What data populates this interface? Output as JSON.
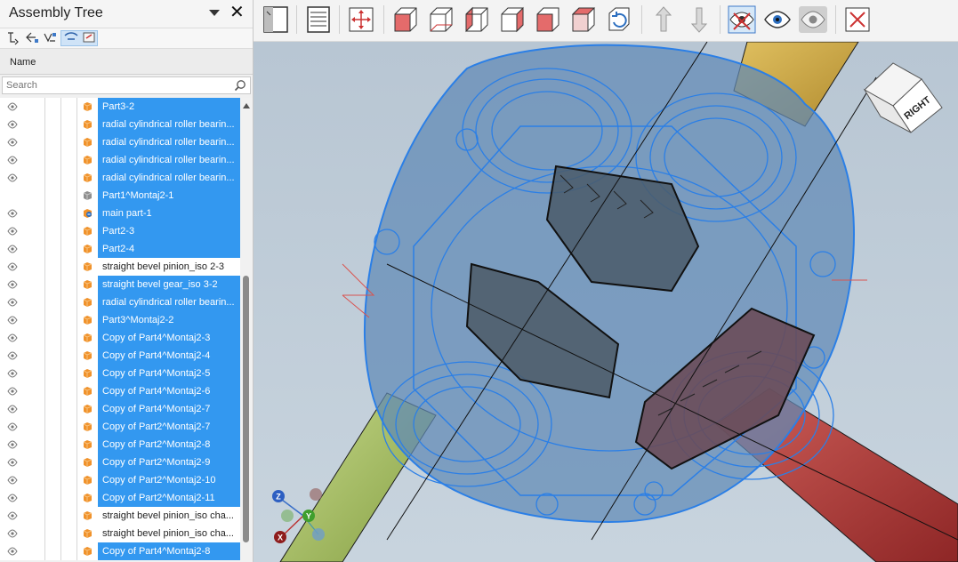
{
  "panel": {
    "title": "Assembly Tree",
    "column_header": "Name",
    "search_placeholder": "Search"
  },
  "tree": {
    "rows": [
      {
        "label": "Part3-2",
        "selected": true,
        "eye": true,
        "icon": "part-icon"
      },
      {
        "label": "radial cylindrical roller bearin...",
        "selected": true,
        "eye": true,
        "icon": "part-icon"
      },
      {
        "label": "radial cylindrical roller bearin...",
        "selected": true,
        "eye": true,
        "icon": "part-icon"
      },
      {
        "label": "radial cylindrical roller bearin...",
        "selected": true,
        "eye": true,
        "icon": "part-icon"
      },
      {
        "label": "radial cylindrical roller bearin...",
        "selected": true,
        "eye": true,
        "icon": "part-icon"
      },
      {
        "label": "Part1^Montaj2-1",
        "selected": true,
        "eye": false,
        "icon": "part-hidden-icon"
      },
      {
        "label": "main part-1",
        "selected": true,
        "eye": true,
        "icon": "assembly-icon"
      },
      {
        "label": "Part2-3",
        "selected": true,
        "eye": true,
        "icon": "part-icon"
      },
      {
        "label": "Part2-4",
        "selected": true,
        "eye": true,
        "icon": "part-icon"
      },
      {
        "label": "straight bevel pinion_iso 2-3",
        "selected": false,
        "eye": true,
        "icon": "part-icon"
      },
      {
        "label": "straight bevel gear_iso 3-2",
        "selected": true,
        "eye": true,
        "icon": "part-icon"
      },
      {
        "label": "radial cylindrical roller bearin...",
        "selected": true,
        "eye": true,
        "icon": "part-icon"
      },
      {
        "label": "Part3^Montaj2-2",
        "selected": true,
        "eye": true,
        "icon": "part-icon"
      },
      {
        "label": "Copy of Part4^Montaj2-3",
        "selected": true,
        "eye": true,
        "icon": "part-icon"
      },
      {
        "label": "Copy of Part4^Montaj2-4",
        "selected": true,
        "eye": true,
        "icon": "part-icon"
      },
      {
        "label": "Copy of Part4^Montaj2-5",
        "selected": true,
        "eye": true,
        "icon": "part-icon"
      },
      {
        "label": "Copy of Part4^Montaj2-6",
        "selected": true,
        "eye": true,
        "icon": "part-icon"
      },
      {
        "label": "Copy of Part4^Montaj2-7",
        "selected": true,
        "eye": true,
        "icon": "part-icon"
      },
      {
        "label": "Copy of Part2^Montaj2-7",
        "selected": true,
        "eye": true,
        "icon": "part-icon"
      },
      {
        "label": "Copy of Part2^Montaj2-8",
        "selected": true,
        "eye": true,
        "icon": "part-icon"
      },
      {
        "label": "Copy of Part2^Montaj2-9",
        "selected": true,
        "eye": true,
        "icon": "part-icon"
      },
      {
        "label": "Copy of Part2^Montaj2-10",
        "selected": true,
        "eye": true,
        "icon": "part-icon"
      },
      {
        "label": "Copy of Part2^Montaj2-11",
        "selected": true,
        "eye": true,
        "icon": "part-icon"
      },
      {
        "label": "straight bevel pinion_iso cha...",
        "selected": false,
        "eye": true,
        "icon": "part-icon"
      },
      {
        "label": "straight bevel pinion_iso cha...",
        "selected": false,
        "eye": true,
        "icon": "part-icon"
      },
      {
        "label": "Copy of Part4^Montaj2-8",
        "selected": true,
        "eye": true,
        "icon": "part-icon"
      }
    ]
  },
  "toolbar": {
    "buttons": [
      "panel-toggle-button",
      "properties-button",
      "fit-view-button",
      "view-front-button",
      "view-back-button",
      "view-left-button",
      "view-right-button",
      "view-top-button",
      "view-bottom-button",
      "rotate-view-button",
      "explode-up-button",
      "explode-down-button",
      "hide-selected-button",
      "show-button",
      "show-all-button",
      "close-button"
    ]
  },
  "viewcube": {
    "face_label": "RIGHT"
  },
  "triad": {
    "x": "X",
    "y": "Y",
    "z": "Z"
  },
  "colors": {
    "selection": "#3398f0",
    "part_icon": "#f0922b",
    "shaft_green": "#9fb65a",
    "shaft_red": "#b43a3a",
    "shaft_gold": "#c9a544",
    "wireframe": "#2b7fe6"
  }
}
